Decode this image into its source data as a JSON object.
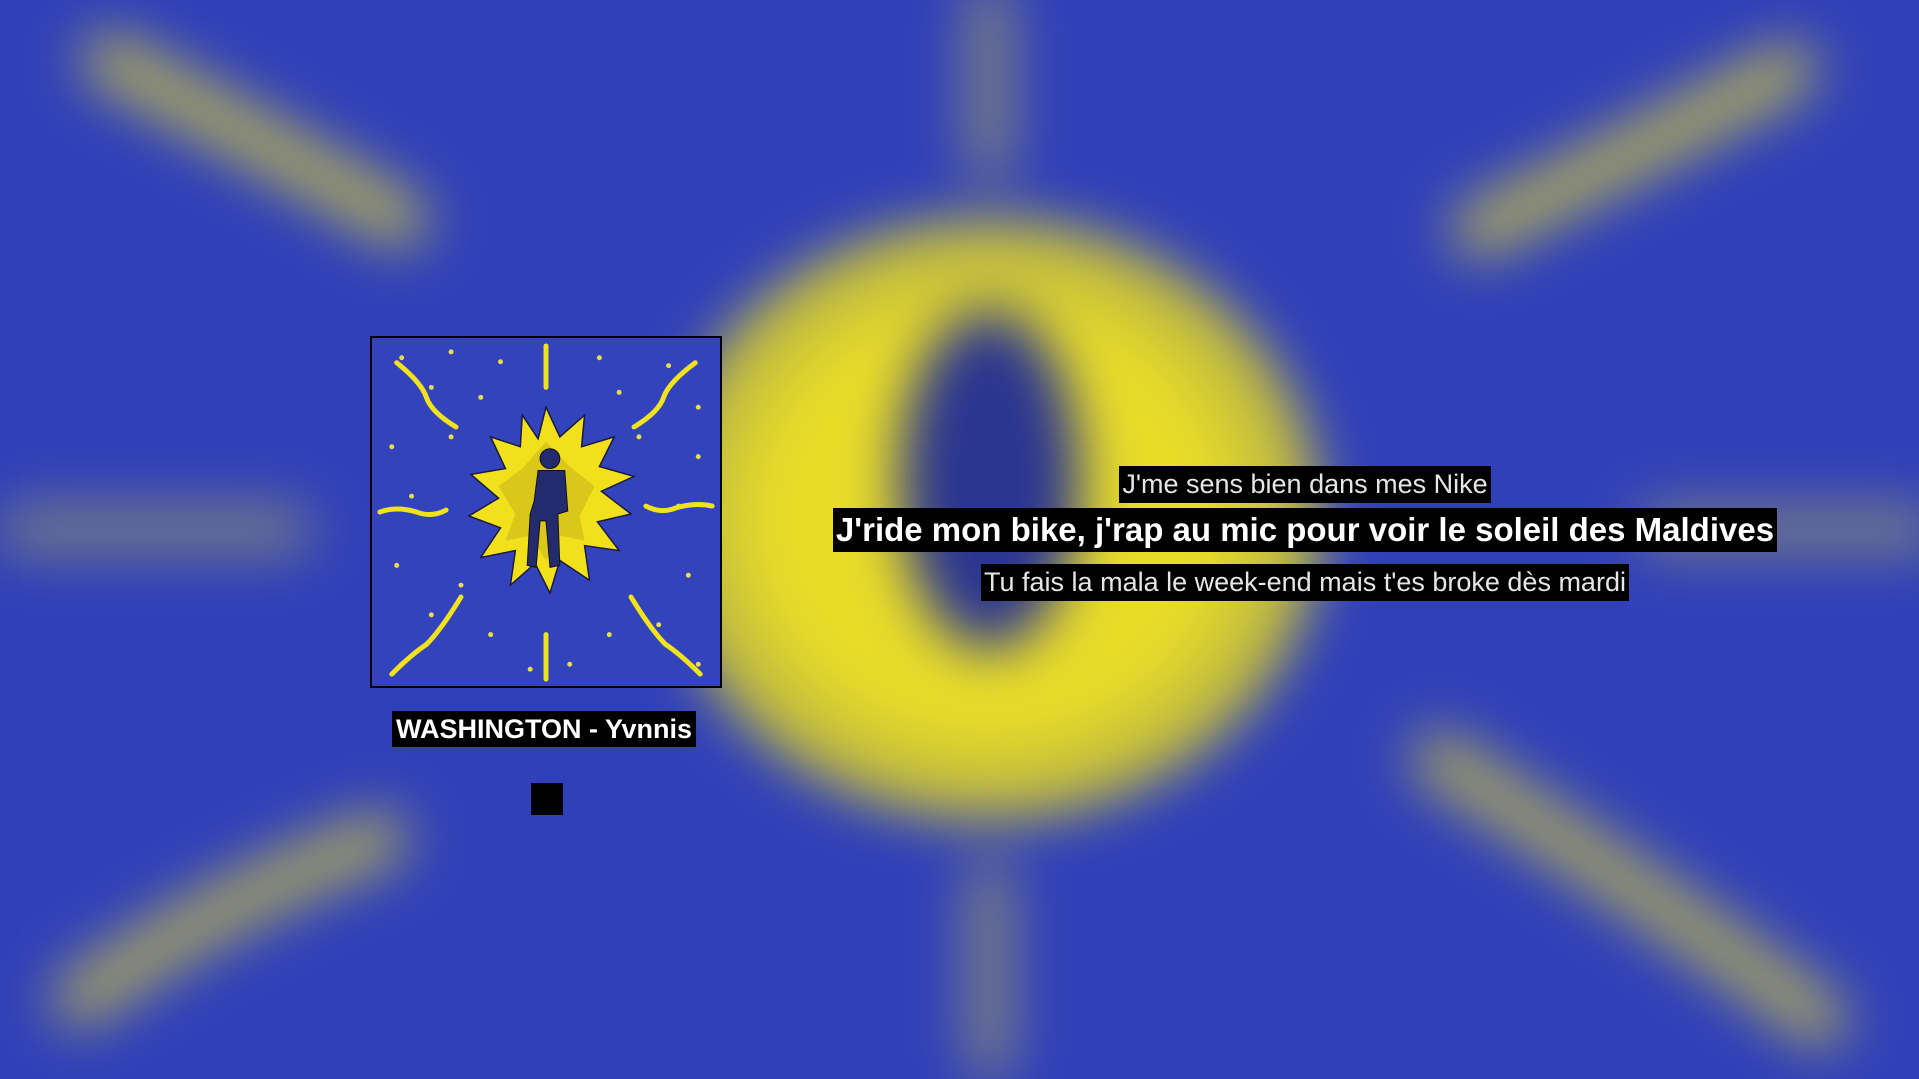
{
  "player": {
    "track_title": "WASHINGTON - Yvnnis",
    "play_toggle_icon": "stop-icon"
  },
  "lyrics": {
    "previous": "J'me sens bien dans mes Nike",
    "current": "J'ride mon bike, j'rap au mic pour voir le soleil des Maldives",
    "next": "Tu fais la mala le week-end mais t'es broke dès mardi"
  },
  "colors": {
    "background_blue": "#2f3fb8",
    "art_yellow": "#f2e21e",
    "label_background": "#000000",
    "label_text": "#ffffff"
  }
}
